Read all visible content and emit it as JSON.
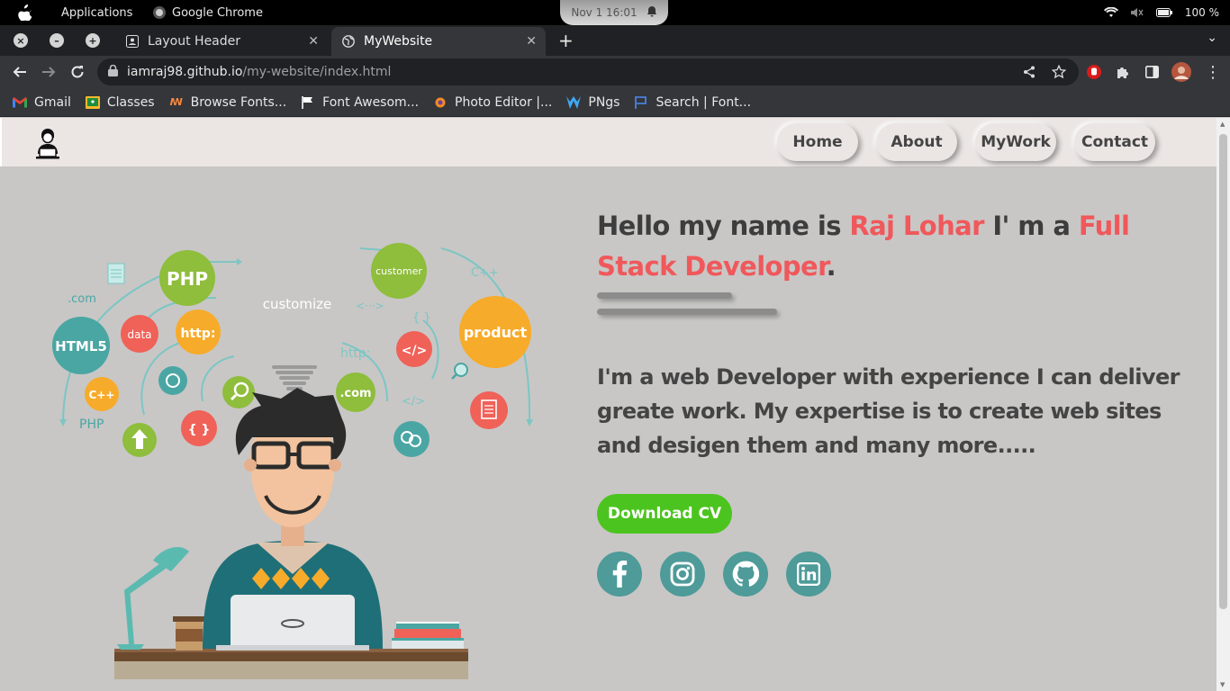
{
  "os_bar": {
    "applications_label": "Applications",
    "app_name": "Google Chrome",
    "clock": "Nov 1  16:01",
    "battery": "100 %"
  },
  "tabs": [
    {
      "title": "Layout Header"
    },
    {
      "title": "MyWebsite"
    }
  ],
  "address_bar": {
    "url_host": "iamraj98.github.io",
    "url_path": "/my-website/index.html"
  },
  "bookmarks": [
    {
      "label": "Gmail",
      "icon": "gmail-icon"
    },
    {
      "label": "Classes",
      "icon": "classroom-icon"
    },
    {
      "label": "Browse Fonts...",
      "icon": "fonts-icon"
    },
    {
      "label": "Font Awesom...",
      "icon": "flag-icon"
    },
    {
      "label": "Photo Editor |...",
      "icon": "photo-editor-icon"
    },
    {
      "label": "PNgs",
      "icon": "pngs-icon"
    },
    {
      "label": "Search | Font...",
      "icon": "search-font-icon"
    }
  ],
  "site": {
    "nav": {
      "home": "Home",
      "about": "About",
      "mywork": "MyWork",
      "contact": "Contact"
    },
    "hero": {
      "title_1": "Hello my name is ",
      "name": "Raj Lohar",
      "title_2": " I' m a ",
      "role": "Full Stack Developer",
      "title_end": ".",
      "description": "I'm a web Developer with experience I can deliver greate work. My expertise is to create web sites and desigen them and many more.....",
      "cta": "Download CV"
    },
    "illustration_labels": {
      "php": "PHP",
      "html": "HTML5",
      "data": "data",
      "http": "http:",
      "customize": "customize",
      "customer": "customer",
      "product": "product",
      "cpp": "C++",
      "dotcom": ".com",
      "http2": "http:",
      "php2": "PHP",
      "braces": "{ }",
      "tag": "</>",
      "arrows": "<···>",
      "cpp2": "C++",
      "dotcom2": ".com"
    },
    "colors": {
      "accent": "#f0585b",
      "cta": "#4cc41f",
      "social": "#4e9b99",
      "header_bg": "#ebe6e4",
      "page_bg": "#c8c7c6"
    }
  }
}
